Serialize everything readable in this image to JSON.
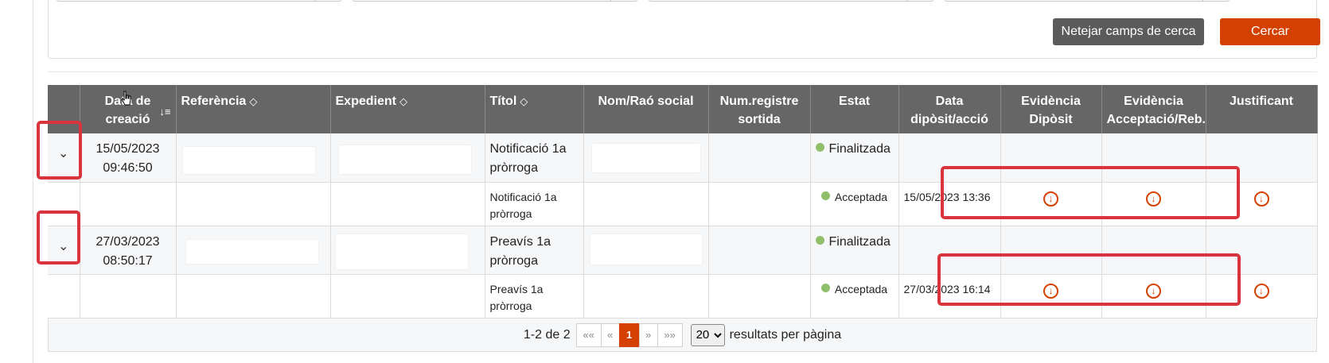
{
  "search": {
    "clear_label": "Netejar camps de cerca",
    "search_label": "Cercar"
  },
  "table": {
    "headers": {
      "date_line1": "Data de",
      "date_line2": "creació",
      "reference": "Referència",
      "expedient": "Expedient",
      "title": "Títol",
      "name": "Nom/Raó social",
      "registry_line1": "Num.registre",
      "registry_line2": "sortida",
      "status": "Estat",
      "deposit_date_line1": "Data",
      "deposit_date_line2": "dipòsit/acció",
      "ev_deposit_line1": "Evidència",
      "ev_deposit_line2": "Dipòsit",
      "ev_accept_line1": "Evidència",
      "ev_accept_line2": "Acceptació/Reb.",
      "receipt": "Justificant"
    },
    "rows": [
      {
        "date": "15/05/2023",
        "time": "09:46:50",
        "title_line1": "Notificació 1a",
        "title_line2": "pròrroga",
        "status": "Finalitzada",
        "sub": {
          "title_line1": "Notificació 1a",
          "title_line2": "pròrroga",
          "status": "Acceptada",
          "deposit_date": "15/05/2023 13:36"
        }
      },
      {
        "date": "27/03/2023",
        "time": "08:50:17",
        "title_line1": "Preavís 1a",
        "title_line2": "pròrroga",
        "status": "Finalitzada",
        "sub": {
          "title_line1": "Preavís 1a",
          "title_line2": "pròrroga",
          "status": "Acceptada",
          "deposit_date": "27/03/2023 16:14"
        }
      }
    ]
  },
  "pager": {
    "summary": "1-2 de 2",
    "first": "««",
    "prev": "«",
    "current": "1",
    "next": "»",
    "last": "»»",
    "per_page": "20",
    "per_page_label": "resultats per pàgina"
  },
  "colors": {
    "accent": "#d44000",
    "header_bg": "#666666",
    "status_dot": "#8fbf6a",
    "highlight_box": "#d9343d"
  },
  "icons": {
    "expand": "chevron-down-icon",
    "download": "download-circle-icon",
    "sort": "sort-icon"
  }
}
